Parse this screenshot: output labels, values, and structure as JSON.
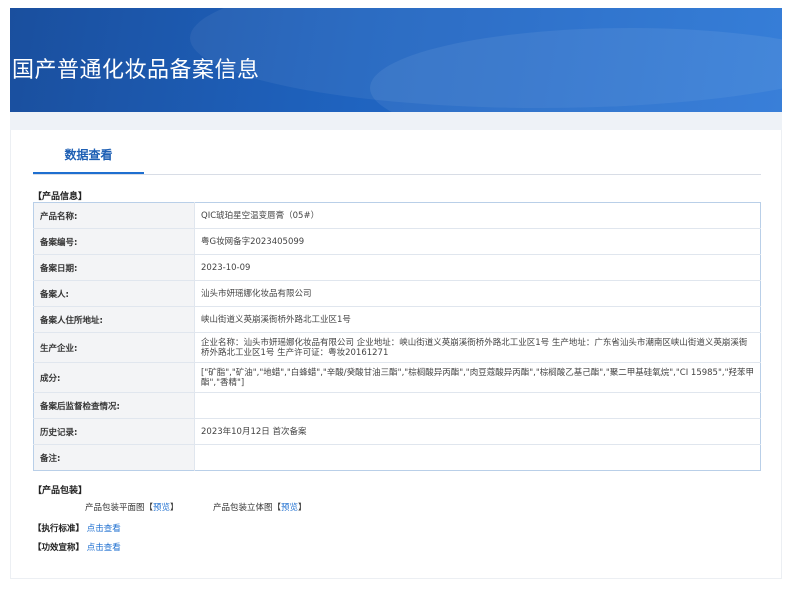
{
  "header": {
    "title": "国产普通化妆品备案信息"
  },
  "tabs": [
    {
      "label": "数据查看"
    }
  ],
  "product_info": {
    "section_label": "【产品信息】",
    "rows": [
      {
        "key": "产品名称:",
        "value": "QIC琥珀星空温变唇膏（05#）"
      },
      {
        "key": "备案编号:",
        "value": "粤G妆网备字2023405099"
      },
      {
        "key": "备案日期:",
        "value": "2023-10-09"
      },
      {
        "key": "备案人:",
        "value": "汕头市妍瑶娜化妆品有限公司"
      },
      {
        "key": "备案人住所地址:",
        "value": "峡山街道义英崩溪衙桥外路北工业区1号"
      },
      {
        "key": "生产企业:",
        "value": "企业名称：汕头市妍瑶娜化妆品有限公司 企业地址：峡山街道义英崩溪衙桥外路北工业区1号 生产地址：广东省汕头市潮南区峡山街道义英崩溪衙桥外路北工业区1号 生产许可证：粤妆20161271"
      },
      {
        "key": "成分:",
        "value": "[\"矿脂\",\"矿油\",\"地蜡\",\"白蜂蜡\",\"辛酸/癸酸甘油三酯\",\"棕榈酸异丙酯\",\"肉豆蔻酸异丙酯\",\"棕榈酸乙基己酯\",\"聚二甲基硅氧烷\",\"CI 15985\",\"羟苯甲酯\",\"香精\"]"
      },
      {
        "key": "备案后监督检查情况:",
        "value": ""
      },
      {
        "key": "历史记录:",
        "value": "2023年10月12日 首次备案"
      },
      {
        "key": "备注:",
        "value": ""
      }
    ]
  },
  "packaging": {
    "section_label": "【产品包装】",
    "flat_label": "产品包装平面图",
    "flat_preview": "预览",
    "stereo_label": "产品包装立体图",
    "stereo_preview": "预览",
    "bracket_open": "【",
    "bracket_close": "】"
  },
  "standard": {
    "label": "【执行标准】",
    "link": "点击查看"
  },
  "efficacy": {
    "label": "【功效宣称】",
    "link": "点击查看"
  },
  "colors": {
    "banner": "#1f63bf",
    "accent": "#1e6fd0",
    "table_border": "#b9cfe8"
  }
}
